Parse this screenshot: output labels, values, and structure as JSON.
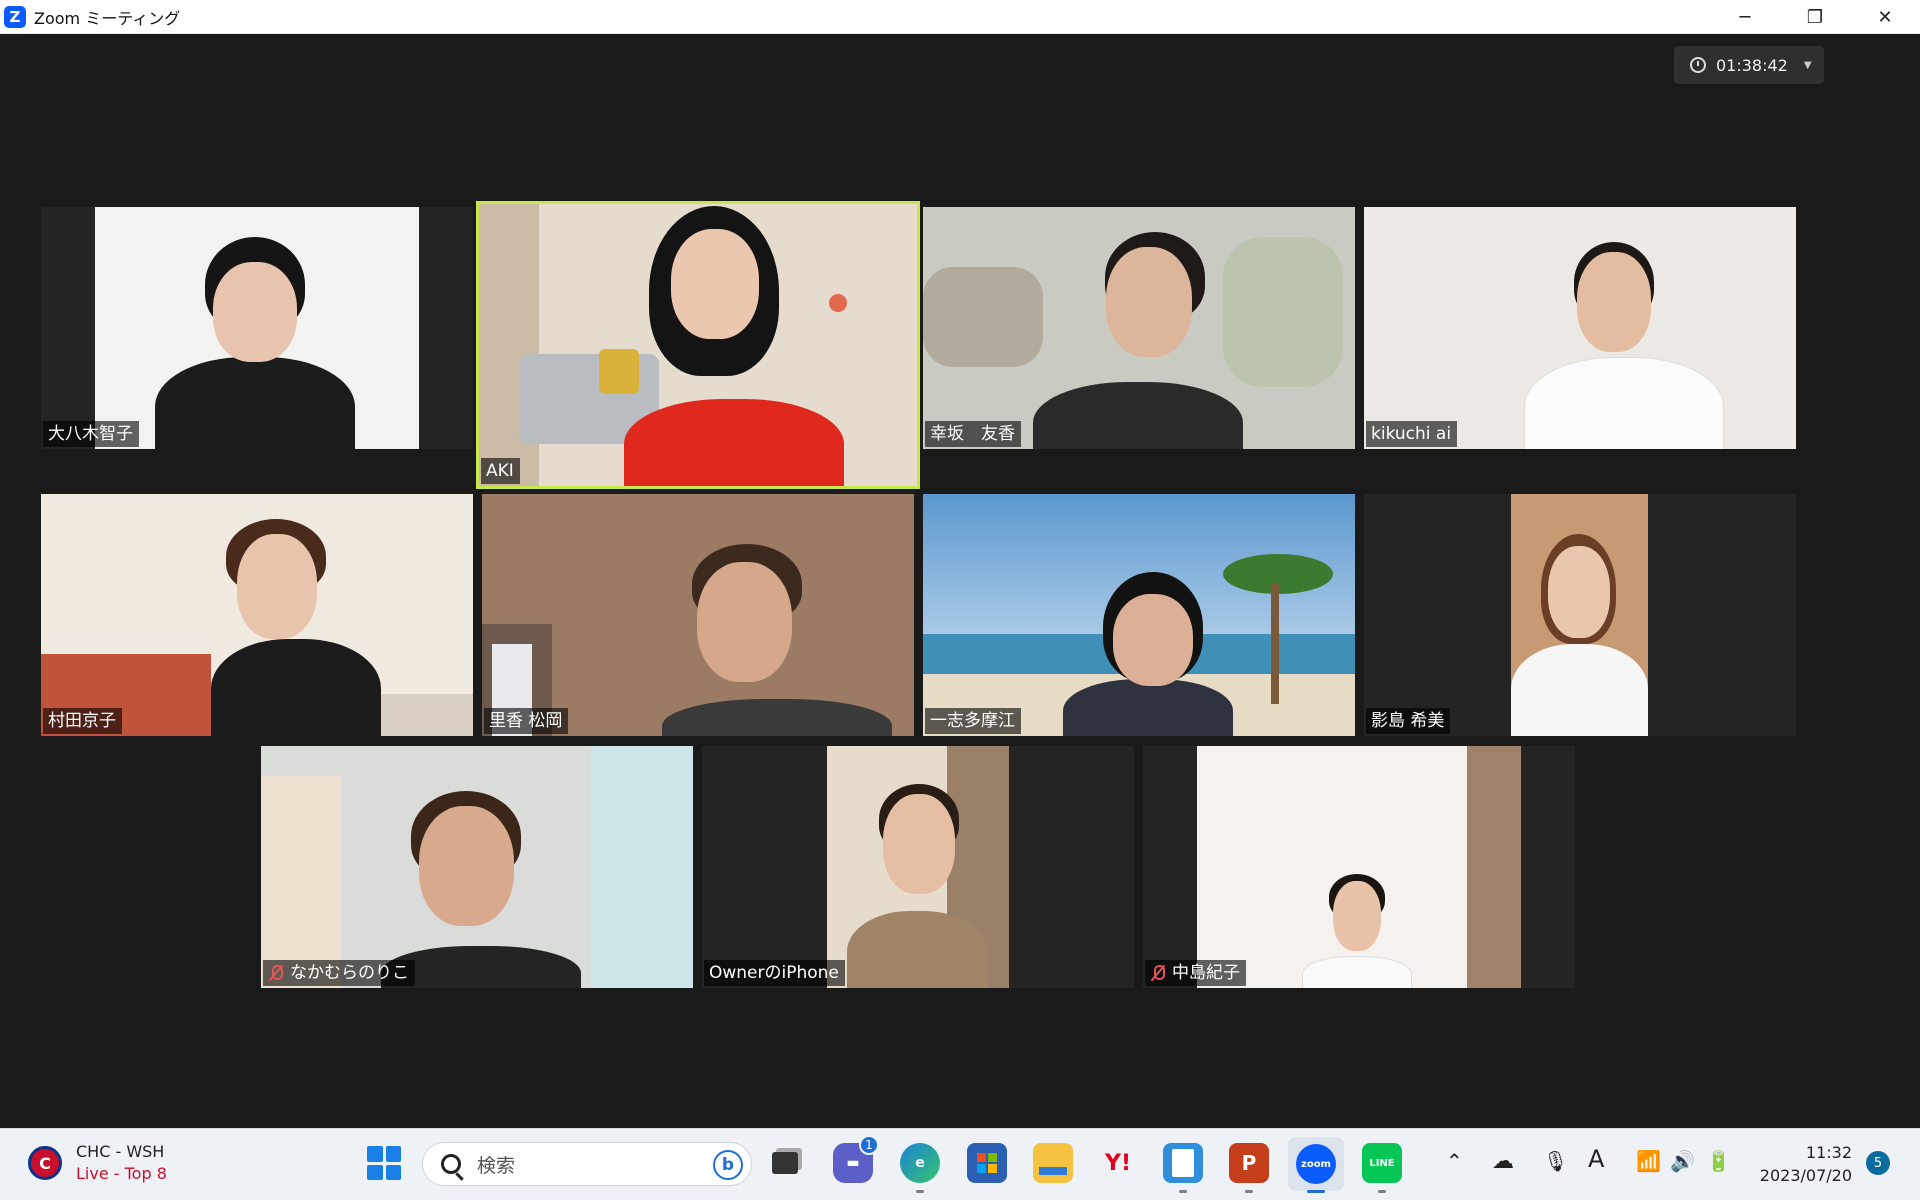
{
  "window": {
    "title": "Zoom ミーティング",
    "app_logo_letter": "Z",
    "minimize": "─",
    "restore": "❐",
    "close": "✕"
  },
  "meeting": {
    "timer": "01:38:42",
    "active_speaker_color": "#c9e64a",
    "participants": [
      {
        "name": "大八木智子",
        "muted": false
      },
      {
        "name": "AKI",
        "muted": false,
        "active_speaker": true
      },
      {
        "name": "幸坂　友香",
        "muted": false
      },
      {
        "name": "kikuchi ai",
        "muted": false
      },
      {
        "name": "村田京子",
        "muted": false
      },
      {
        "name": "里香 松岡",
        "muted": false
      },
      {
        "name": "一志多摩江",
        "muted": false
      },
      {
        "name": "影島 希美",
        "muted": false
      },
      {
        "name": "なかむらのりこ",
        "muted": true
      },
      {
        "name": "OwnerのiPhone",
        "muted": false
      },
      {
        "name": "中島紀子",
        "muted": true
      }
    ]
  },
  "taskbar": {
    "weather": {
      "line1": "CHC - WSH",
      "line2": "Live - Top 8",
      "icon": "C"
    },
    "search_placeholder": "検索",
    "bing_letter": "b",
    "teams_badge": "1",
    "yahoo_label": "Y!",
    "zoom_label": "zoom",
    "line_label": "LINE",
    "powerpoint_label": "P",
    "time": "11:32",
    "date": "2023/07/20",
    "notification_count": "5",
    "ime_label": "A"
  }
}
